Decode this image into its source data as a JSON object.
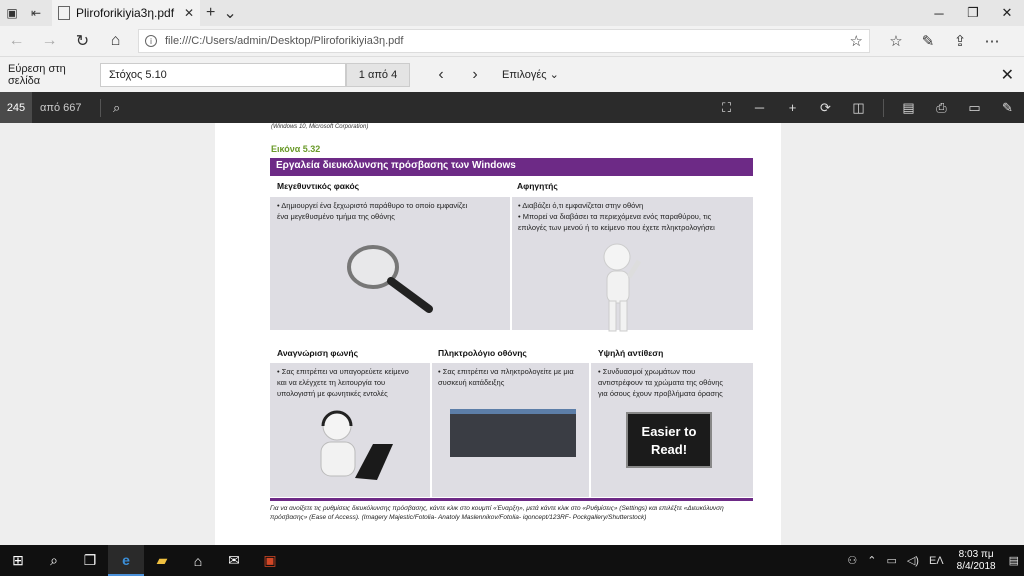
{
  "tabs": [
    {
      "title": "Pliroforikiyia3η.pdf"
    }
  ],
  "address": {
    "url": "file:///C:/Users/admin/Desktop/Pliroforikiyia3η.pdf"
  },
  "find": {
    "label": "Εύρεση στη σελίδα",
    "query": "Στόχος 5.10",
    "count": "1 από 4",
    "options": "Επιλογές"
  },
  "pdf": {
    "page": "245",
    "of": "από 667"
  },
  "document": {
    "credit_top": "(Windows 10, Microsoft Corporation)",
    "figure_label": "Εικόνα 5.32",
    "band_title": "Εργαλεία διευκόλυνσης πρόσβασης των Windows",
    "cells": [
      {
        "title": "Μεγεθυντικός φακός",
        "bullets": [
          "• Δημιουργεί ένα ξεχωριστό παράθυρο το οποίο εμφανίζει",
          "  ένα μεγεθυσμένο τμήμα της οθόνης"
        ]
      },
      {
        "title": "Αφηγητής",
        "bullets": [
          "• Διαβάζει ό,τι εμφανίζεται στην οθόνη",
          "• Μπορεί να διαβάσει τα περιεχόμενα ενός παραθύρου, τις",
          "  επιλογές των μενού ή το κείμενο που έχετε πληκτρολογήσει"
        ]
      },
      {
        "title": "Αναγνώριση φωνής",
        "bullets": [
          "• Σας επιτρέπει να υπαγορεύετε κείμενο",
          "  και να ελέγχετε τη λειτουργία του",
          "  υπολογιστή με φωνητικές εντολές"
        ]
      },
      {
        "title": "Πληκτρολόγιο οθόνης",
        "bullets": [
          "• Σας επιτρέπει να πληκτρολογείτε με μια",
          "  συσκευή κατάδειξης"
        ]
      },
      {
        "title": "Υψηλή αντίθεση",
        "bullets": [
          "• Συνδυασμοί χρωμάτων που",
          "  αντιστρέφουν τα χρώματα της οθόνης",
          "  για όσους έχουν προβλήματα όρασης"
        ]
      }
    ],
    "easier_line1": "Easier to",
    "easier_line2": "Read!",
    "caption": "Για να ανοίξετε τις ρυθμίσεις διευκόλυνσης πρόσβασης, κάντε κλικ στο κουμπί «Έναρξη», μετά κάντε κλικ στο «Ρυθμίσεις» (Settings) και επιλέξτε «Διευκόλυνση πρόσβασης» (Ease of Access). (Imagery Majestic/Fotolia- Anatoly Maslennikov/Fotolia- iqoncept/123RF- Pockgallery/Shutterstock)"
  },
  "taskbar": {
    "lang": "ΕΛ",
    "time": "8:03 πμ",
    "date": "8/4/2018"
  }
}
